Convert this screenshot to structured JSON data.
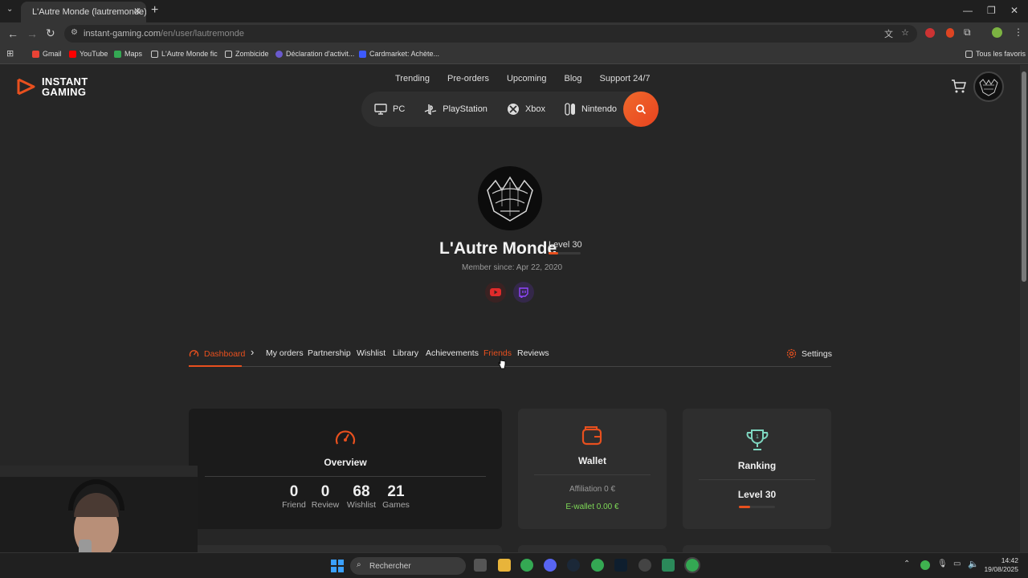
{
  "browser": {
    "tab_title": "L'Autre Monde (lautremonde) s",
    "url_host": "instant-gaming.com",
    "url_path": "/en/user/lautremonde",
    "bookmarks": [
      "Gmail",
      "YouTube",
      "Maps",
      "L'Autre Monde fic",
      "Zombicide",
      "Déclaration d'activit...",
      "Cardmarket: Achète..."
    ],
    "all_bookmarks": "Tous les favoris"
  },
  "site": {
    "logo_line1": "INSTANT",
    "logo_line2": "GAMING",
    "topnav": [
      "Trending",
      "Pre-orders",
      "Upcoming",
      "Blog",
      "Support 24/7"
    ],
    "platforms": [
      "PC",
      "PlayStation",
      "Xbox",
      "Nintendo"
    ]
  },
  "profile": {
    "name": "L'Autre Monde",
    "level": "Level 30",
    "level_progress": 0.3,
    "member_since": "Member since: Apr 22, 2020"
  },
  "tabs": {
    "items": [
      "Dashboard",
      "My orders",
      "Partnership",
      "Wishlist",
      "Library",
      "Achievements",
      "Friends",
      "Reviews"
    ],
    "active": "Dashboard",
    "hovered": "Friends",
    "settings": "Settings"
  },
  "overview": {
    "title": "Overview",
    "stats": [
      {
        "value": "0",
        "label": "Friend"
      },
      {
        "value": "0",
        "label": "Review"
      },
      {
        "value": "68",
        "label": "Wishlist"
      },
      {
        "value": "21",
        "label": "Games"
      }
    ]
  },
  "wallet": {
    "title": "Wallet",
    "affiliation": "Affiliation 0 €",
    "ewallet": "E-wallet 0.00 €"
  },
  "ranking": {
    "title": "Ranking",
    "level": "Level 30",
    "trophy_number": "1"
  },
  "taskbar": {
    "search_placeholder": "Rechercher",
    "time": "14:42",
    "date": "19/08/2025"
  },
  "colors": {
    "accent": "#e8501e",
    "ewallet": "#7ed957",
    "trophy": "#7ed6c0",
    "twitch": "#9146ff",
    "youtube": "#e02b2b"
  }
}
